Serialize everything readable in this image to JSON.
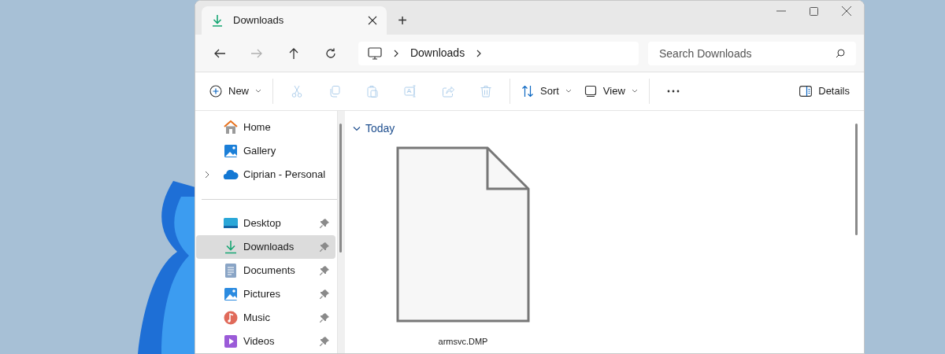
{
  "window": {
    "tabs": [
      {
        "title": "Downloads",
        "selected": true
      }
    ],
    "new_tab": "+"
  },
  "nav": [
    {
      "kind": "back",
      "disabled": false
    },
    {
      "kind": "forward",
      "disabled": true
    },
    {
      "kind": "up",
      "disabled": false
    },
    {
      "kind": "refresh",
      "disabled": false
    }
  ],
  "breadcrumb": [
    "Downloads"
  ],
  "search": {
    "placeholder": "Search Downloads"
  },
  "commands": [
    {
      "kind": "new",
      "label": "New",
      "disabled": false
    },
    {
      "kind": "cut",
      "disabled": true
    },
    {
      "kind": "copy",
      "disabled": true
    },
    {
      "kind": "paste",
      "disabled": true
    },
    {
      "kind": "rename",
      "disabled": true
    },
    {
      "kind": "share",
      "disabled": true
    },
    {
      "kind": "delete",
      "disabled": true
    },
    {
      "kind": "sort",
      "label": "Sort",
      "disabled": false
    },
    {
      "kind": "view",
      "label": "View",
      "disabled": false
    },
    {
      "kind": "more",
      "disabled": false
    }
  ],
  "details": "Details",
  "sidebar": {
    "items": [
      {
        "kind": "home",
        "label": "Home",
        "selected": false,
        "pinned": false
      },
      {
        "kind": "gallery",
        "label": "Gallery",
        "selected": false,
        "pinned": false
      },
      {
        "kind": "cloud",
        "label": "Ciprian - Personal",
        "selected": false,
        "pinned": false,
        "expanded": false
      },
      {
        "kind": "separator"
      },
      {
        "kind": "desktop",
        "label": "Desktop",
        "selected": false,
        "pinned": true
      },
      {
        "kind": "downloads",
        "label": "Downloads",
        "selected": true,
        "pinned": true
      },
      {
        "kind": "documents",
        "label": "Documents",
        "selected": false,
        "pinned": true
      },
      {
        "kind": "pictures",
        "label": "Pictures",
        "selected": false,
        "pinned": true
      },
      {
        "kind": "music",
        "label": "Music",
        "selected": false,
        "pinned": true
      },
      {
        "kind": "videos",
        "label": "Videos",
        "selected": false,
        "pinned": true
      }
    ]
  },
  "content": {
    "groups": [
      {
        "title": "Today",
        "expanded": true,
        "files": [
          {
            "name": "armsvc.DMP"
          }
        ]
      }
    ]
  }
}
